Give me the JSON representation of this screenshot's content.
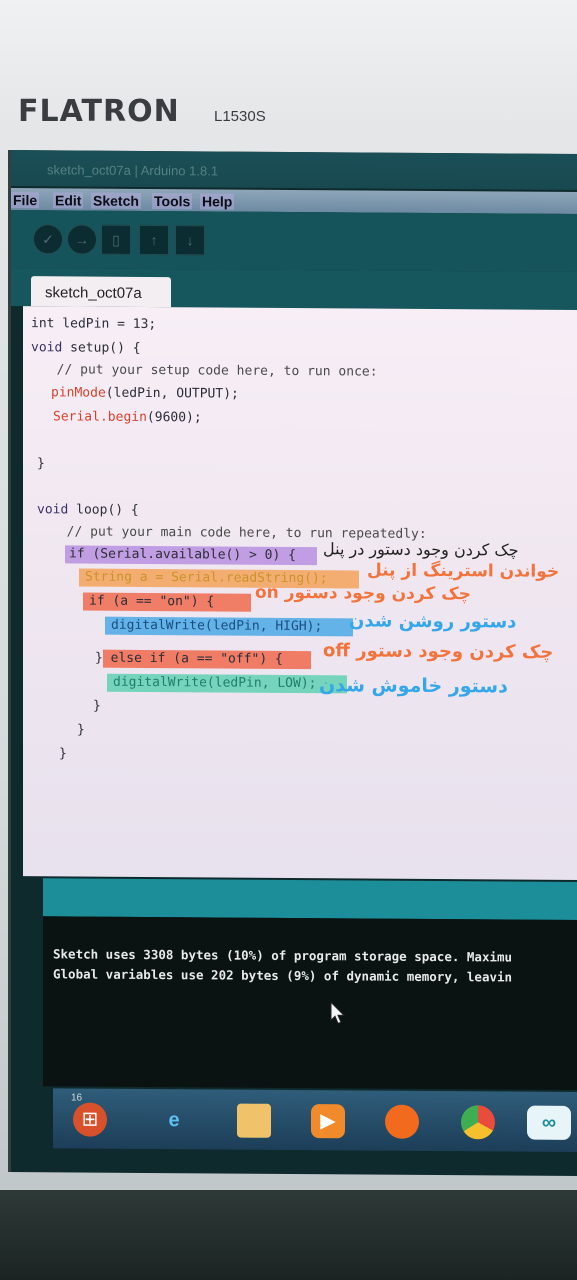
{
  "monitor": {
    "brand": "FLATRON",
    "model": "L1530S"
  },
  "window": {
    "title": "sketch_oct07a | Arduino 1.8.1"
  },
  "menu": [
    "File",
    "Edit",
    "Sketch",
    "Tools",
    "Help"
  ],
  "toolbar": {
    "buttons": [
      "verify-icon",
      "upload-icon",
      "new-icon",
      "open-icon",
      "save-icon"
    ]
  },
  "tab": {
    "label": "sketch_oct07a"
  },
  "code": {
    "l1": "int ledPin = 13;",
    "l2_kw": "void",
    "l2_rest": " setup() {",
    "l3": "  // put your setup code here, to run once:",
    "l4_fn": "pinMode",
    "l4_rest": "(ledPin, OUTPUT);",
    "l5_fn": "Serial.begin",
    "l5_rest": "(9600);",
    "l6": "}",
    "l7_kw": "void",
    "l7_rest": " loop() {",
    "l8": "  // put your main code here, to run repeatedly:",
    "l9": "if (Serial.available() > 0) {",
    "l10": "String a = Serial.readString();",
    "l11": "if (a == \"on\") {",
    "l12": "digitalWrite(ledPin, HIGH);",
    "l13": "} else if (a == \"off\") {",
    "l14": "digitalWrite(ledPin, LOW);",
    "l15": "}",
    "l16": "}",
    "l17": "}"
  },
  "annotations": {
    "a1": "چک کردن وجود دستور در پنل",
    "a2": "خواندن استرینگ از پنل",
    "a3": "چک کردن وجود دستور on",
    "a4": "دستور روشن شدن",
    "a5": "چک کردن وجود دستور off",
    "a6": "دستور خاموش شدن"
  },
  "console": {
    "line1": "Sketch uses 3308 bytes (10%) of program storage space. Maximu",
    "line2": "Global variables use 202 bytes (9%) of dynamic memory, leavin"
  },
  "status": {
    "line_number": "16"
  },
  "taskbar": {
    "icons": [
      "start-icon",
      "ie-icon",
      "folder-icon",
      "media-icon",
      "firefox-icon",
      "chrome-icon",
      "arduino-icon"
    ]
  },
  "colors": {
    "highlight_purple": "#b98fe0",
    "highlight_orange": "#f5a25a",
    "highlight_red": "#f06a4e",
    "highlight_blue": "#4aa8e6",
    "highlight_green": "#5fd1b2",
    "annotation_orange": "#f2733c",
    "annotation_blue": "#35a7e8"
  }
}
